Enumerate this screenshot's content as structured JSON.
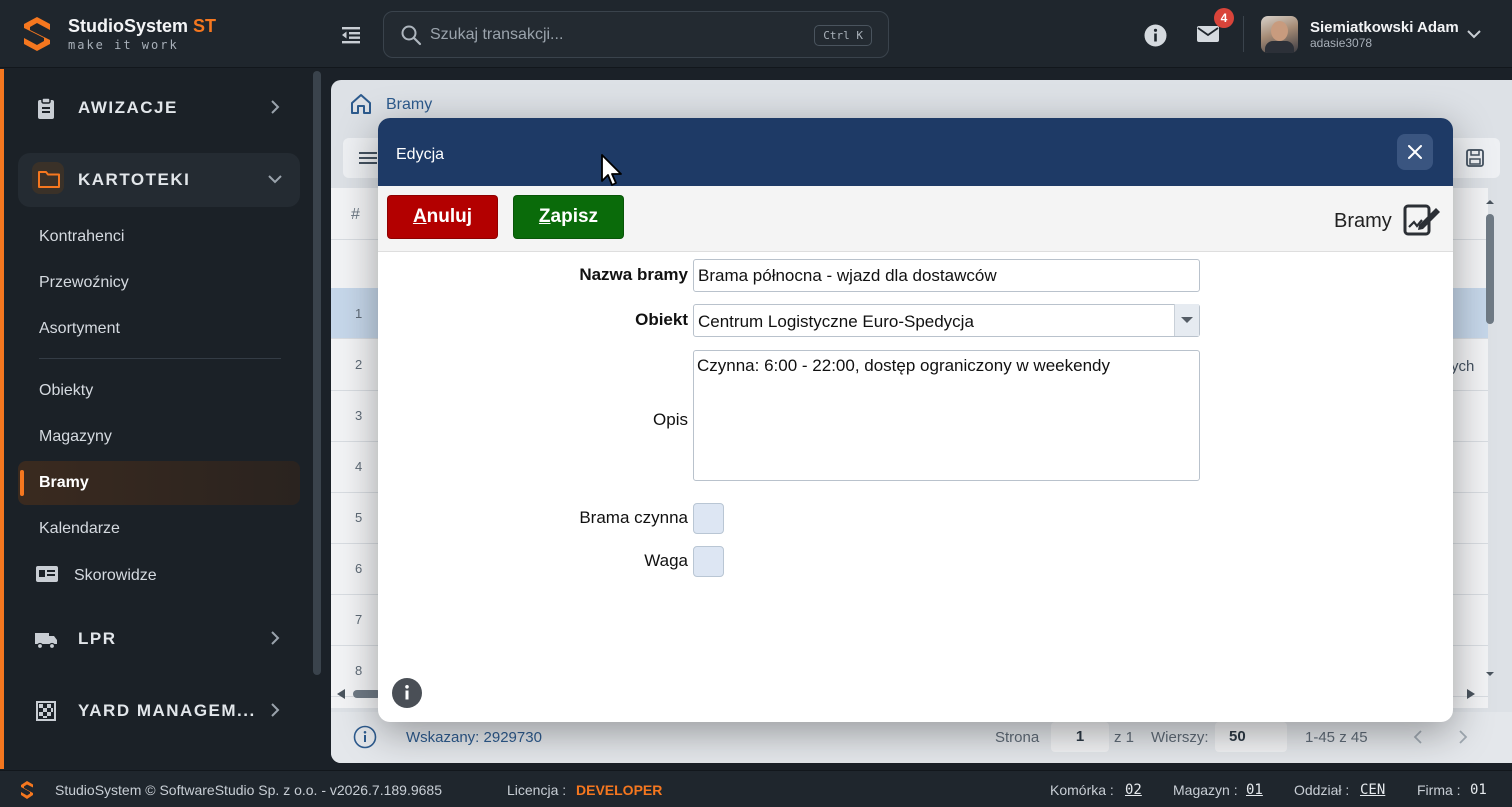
{
  "app": {
    "name": "StudioSystem",
    "name_suffix": "ST",
    "tagline": "make it work"
  },
  "search": {
    "placeholder": "Szukaj transakcji...",
    "shortcut": "Ctrl K"
  },
  "notifications": {
    "count": "4"
  },
  "user": {
    "name": "Siemiatkowski Adam",
    "login": "adasie3078"
  },
  "sidebar": {
    "sections": [
      {
        "label": "AWIZACJE",
        "icon": "clipboard-icon"
      },
      {
        "label": "KARTOTEKI",
        "icon": "folder-icon",
        "open": true
      },
      {
        "label": "LPR",
        "icon": "truck-icon"
      },
      {
        "label": "YARD MANAGEM...",
        "icon": "grid-icon"
      }
    ],
    "items": [
      "Kontrahenci",
      "Przewoźnicy",
      "Asortyment",
      "Obiekty",
      "Magazyny",
      "Bramy",
      "Kalendarze",
      "Skorowidze"
    ],
    "active": "Bramy"
  },
  "page": {
    "breadcrumb": "Bramy",
    "grid": {
      "header_symbol": "#",
      "rows": [
        "1",
        "2",
        "3",
        "4",
        "5",
        "6",
        "7",
        "8"
      ],
      "truncated_text": "ych"
    },
    "footer": {
      "selected": "Wskazany: 2929730",
      "page_label": "Strona",
      "page_value": "1",
      "of_pages": "z 1",
      "rows_label": "Wierszy:",
      "rows_value": "50",
      "range": "1-45 z 45"
    }
  },
  "dialog": {
    "title": "Edycja",
    "entity": "Bramy",
    "cancel_label_first": "A",
    "cancel_label_rest": "nuluj",
    "save_label_first": "Z",
    "save_label_rest": "apisz",
    "fields": {
      "name_label": "Nazwa bramy",
      "name_value": "Brama północna - wjazd dla dostawców",
      "object_label": "Obiekt",
      "object_value": "Centrum Logistyczne Euro-Spedycja",
      "desc_label": "Opis",
      "desc_value": "Czynna: 6:00 - 22:00, dostęp ograniczony w weekendy",
      "active_label": "Brama czynna",
      "scale_label": "Waga"
    }
  },
  "statusbar": {
    "copyright": "StudioSystem © SoftwareStudio Sp. z o.o. - v2026.7.189.9685",
    "license_label": "Licencja :",
    "license_value": "DEVELOPER",
    "cell_label": "Komórka :",
    "cell_value": "02",
    "warehouse_label": "Magazyn :",
    "warehouse_value": "01",
    "branch_label": "Oddział :",
    "branch_value": "CEN",
    "company_label": "Firma :",
    "company_value": "01"
  },
  "colors": {
    "accent": "#f5771f",
    "dialog_header": "#1e3a66",
    "cancel": "#b30000",
    "save": "#0a6b0a"
  }
}
